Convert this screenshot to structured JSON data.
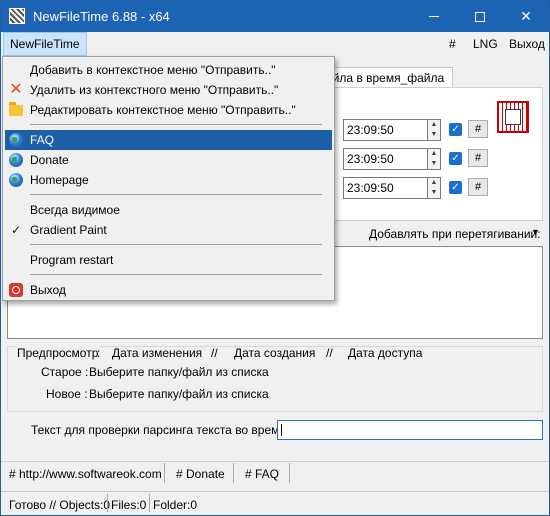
{
  "window": {
    "title": "NewFileTime 6.88 - x64"
  },
  "menubar": {
    "main": "NewFileTime",
    "hash": "#",
    "lng": "LNG",
    "exit": "Выход"
  },
  "panel": {
    "tab_label": "айла в время_файла",
    "times": [
      "23:09:50",
      "23:09:50",
      "23:09:50"
    ],
    "row_hash": "#",
    "drag_label": "Добавлять при перетягивании:"
  },
  "preview": {
    "head": "Предпросмотр",
    "col_sep": ":",
    "cols": [
      "Дата изменения",
      "//",
      "Дата создания",
      "//",
      "Дата доступа"
    ],
    "old_label": "Старое :",
    "old_value": "Выберите папку/файл из списка",
    "new_label": "Новое :",
    "new_value": "Выберите папку/файл из списка"
  },
  "parse": {
    "label": "Текст для проверки парсинга текста во время",
    "value": ""
  },
  "links": [
    "# http://www.softwareok.com",
    "# Donate",
    "# FAQ"
  ],
  "status": [
    "Готово // Objects:0",
    "Files:0",
    "Folder:0"
  ],
  "dropdown": {
    "items": [
      {
        "label": "Добавить в контекстное меню \"Отправить..\"",
        "icon": "plus-icon"
      },
      {
        "label": "Удалить из контекстного меню \"Отправить..\"",
        "icon": "x-icon"
      },
      {
        "label": "Редактировать контекстное меню \"Отправить..\"",
        "icon": "folder-icon"
      },
      {
        "label": "FAQ",
        "icon": "globe-icon"
      },
      {
        "label": "Donate",
        "icon": "globe-icon"
      },
      {
        "label": "Homepage",
        "icon": "globe-icon"
      },
      {
        "label": "Всегда видимое",
        "icon": ""
      },
      {
        "label": "Gradient Paint",
        "icon": "check-icon"
      },
      {
        "label": "Program restart",
        "icon": ""
      },
      {
        "label": "Выход",
        "icon": "power-icon"
      }
    ]
  },
  "colors": {
    "titlebar": "#1e64b4",
    "highlight": "#1f5fa8",
    "accent_check": "#1a6fd1"
  }
}
